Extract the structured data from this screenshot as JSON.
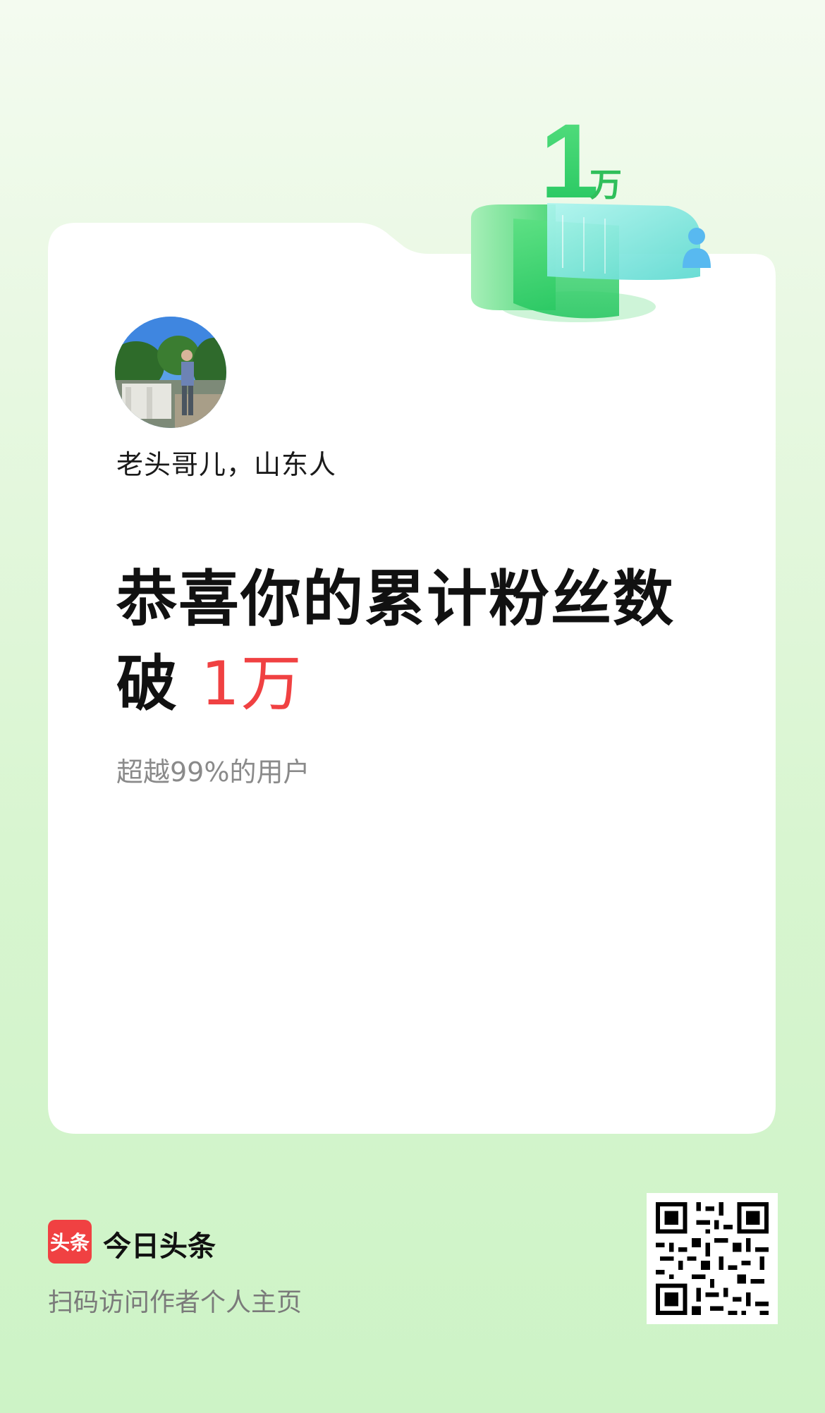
{
  "badge": {
    "number": "1",
    "unit": "万"
  },
  "profile": {
    "name": "老头哥儿，山东人"
  },
  "headline": {
    "line1": "恭喜你的累计粉丝数",
    "line2_prefix": "破 ",
    "line2_highlight": "1万"
  },
  "subline": "超越99%的用户",
  "footer": {
    "logo_text": "头条",
    "app_name": "今日头条",
    "scan_hint": "扫码访问作者个人主页"
  },
  "colors": {
    "accent": "#f04142",
    "green": "#3fd36b",
    "background": "#d8f5d0"
  }
}
